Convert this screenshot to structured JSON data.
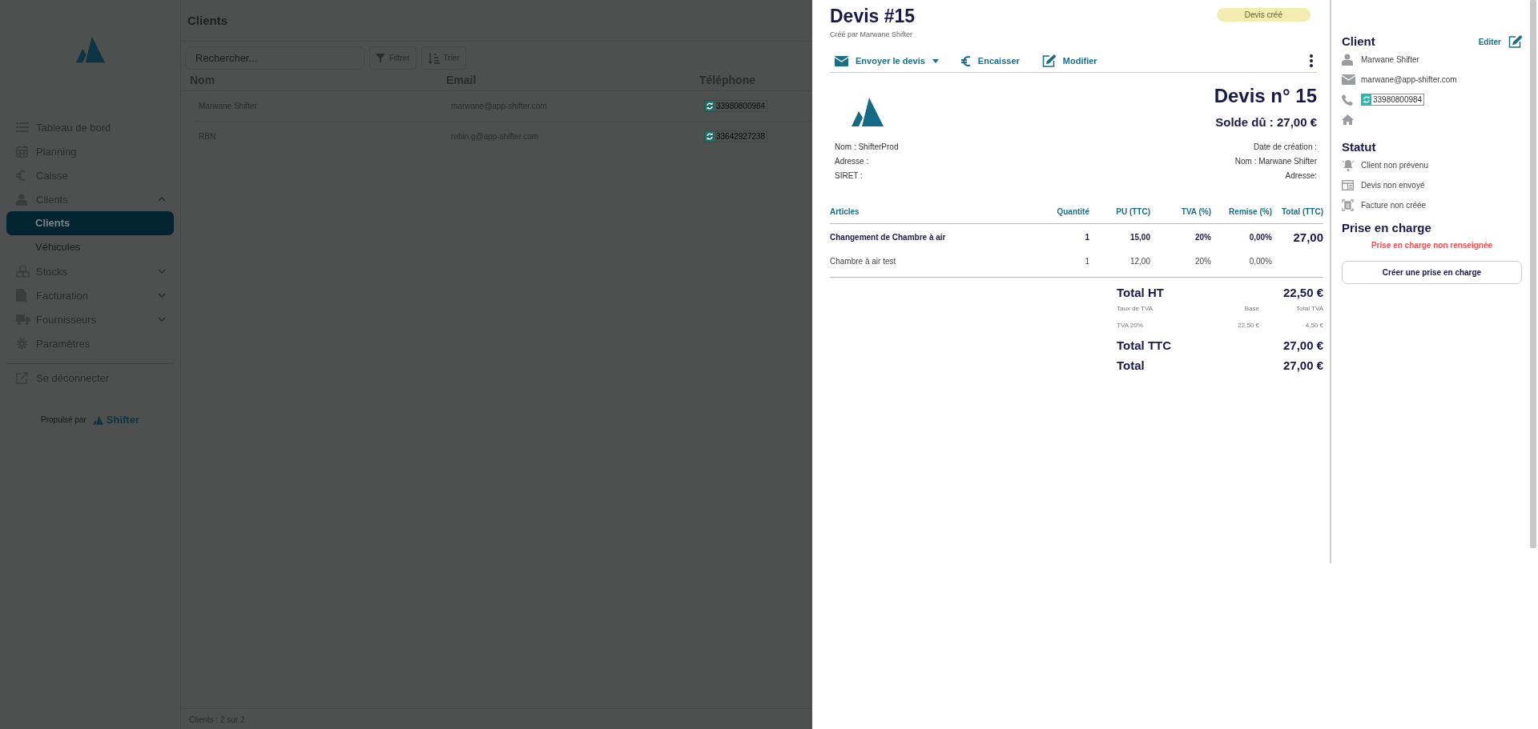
{
  "sidebar": {
    "nav": [
      {
        "label": "Tableau de bord",
        "selected": false
      },
      {
        "label": "Planning",
        "selected": false
      },
      {
        "label": "Caisse",
        "selected": false
      },
      {
        "label": "Clients",
        "selected": false,
        "expanded": true,
        "children": [
          {
            "label": "Clients",
            "selected": true
          },
          {
            "label": "Véhicules",
            "selected": false
          }
        ]
      },
      {
        "label": "Stocks",
        "selected": false,
        "expanded": false
      },
      {
        "label": "Facturation",
        "selected": false,
        "expanded": false
      },
      {
        "label": "Fournisseurs",
        "selected": false,
        "expanded": false
      },
      {
        "label": "Paramètres",
        "selected": false
      }
    ],
    "logout": "Se déconnecter",
    "powered_by": "Propulsé par",
    "brand": "Shifter"
  },
  "main": {
    "title": "Clients",
    "search": {
      "placeholder": "Rechercher..."
    },
    "buttons": [
      "Filtrer",
      "Trier"
    ],
    "table": {
      "columns": [
        "Nom",
        "Email",
        "Téléphone"
      ],
      "rows": [
        {
          "name": "Marwane Shifter",
          "email": "marwane@app-shifter.com",
          "phone": "33980800984"
        },
        {
          "name": "RBN",
          "email": "robin.g@app-shifter.com",
          "phone": "33642927238"
        }
      ]
    },
    "footer": "Clients : 2 sur 2"
  },
  "drawer": {
    "title": "Devis #15",
    "subtitle": "Créé par Marwane Shifter",
    "status": "Devis créé",
    "actions": [
      {
        "label": "Envoyer le devis",
        "dropdown": true
      },
      {
        "label": "Encaisser",
        "dropdown": false
      },
      {
        "label": "Modifier",
        "dropdown": false
      }
    ],
    "document": {
      "heading": "Devis n° 15",
      "balance": "Solde dû : 27,00 €",
      "company": [
        "Nom : ShifterProd",
        "Adresse :",
        "SIRET :"
      ],
      "client": [
        "Date de création :",
        "Nom : Marwane Shifter",
        "Adresse:"
      ],
      "columns": [
        "Articles",
        "Quantité",
        "PU (TTC)",
        "TVA (%)",
        "Remise (%)",
        "Total (TTC)"
      ],
      "rows": [
        {
          "kind": "group",
          "cells": [
            "Changement de Chambre à air",
            "1",
            "15,00",
            "20%",
            "0,00%",
            "27,00"
          ]
        },
        {
          "kind": "item",
          "cells": [
            "Chambre à air test",
            "1",
            "12,00",
            "20%",
            "0,00%"
          ]
        }
      ],
      "totals": {
        "total_ht": {
          "label": "Total HT",
          "value": "22,50 €"
        },
        "vat_columns": [
          "Taux de TVA",
          "Base",
          "Total TVA"
        ],
        "vat_rows": [
          [
            "TVA 20%",
            "22.50 €",
            "4,50 €"
          ]
        ],
        "grand": [
          {
            "label": "Total TTC",
            "value": "27,00 €"
          },
          {
            "label": "Total",
            "value": "27,00 €"
          }
        ]
      }
    }
  },
  "client_panel": {
    "title": "Client",
    "edit": "Editer",
    "name": "Marwane Shifter",
    "email": "marwane@app-shifter.com",
    "phone": "33980800984",
    "status_title": "Statut",
    "statuses": [
      "Client non prévenu",
      "Devis non envoyé",
      "Facture non créée"
    ],
    "care_title": "Prise en charge",
    "care_warning": "Prise en charge non renseignée",
    "care_button": "Créer une prise en charge"
  }
}
